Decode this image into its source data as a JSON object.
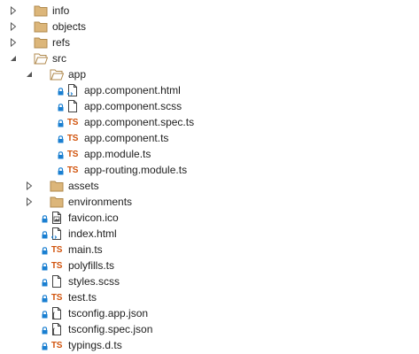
{
  "tree": [
    {
      "label": "info",
      "type": "folder",
      "expanded": false,
      "depth": 0
    },
    {
      "label": "objects",
      "type": "folder",
      "expanded": false,
      "depth": 0
    },
    {
      "label": "refs",
      "type": "folder",
      "expanded": false,
      "depth": 0
    },
    {
      "label": "src",
      "type": "folder",
      "expanded": true,
      "depth": 0
    },
    {
      "label": "app",
      "type": "folder",
      "expanded": true,
      "depth": 1
    },
    {
      "label": "app.component.html",
      "type": "html",
      "locked": true,
      "depth": 2
    },
    {
      "label": "app.component.scss",
      "type": "scss",
      "locked": true,
      "depth": 2
    },
    {
      "label": "app.component.spec.ts",
      "type": "ts",
      "locked": true,
      "depth": 2
    },
    {
      "label": "app.component.ts",
      "type": "ts",
      "locked": true,
      "depth": 2
    },
    {
      "label": "app.module.ts",
      "type": "ts",
      "locked": true,
      "depth": 2
    },
    {
      "label": "app-routing.module.ts",
      "type": "ts",
      "locked": true,
      "depth": 2
    },
    {
      "label": "assets",
      "type": "folder",
      "expanded": false,
      "depth": 1
    },
    {
      "label": "environments",
      "type": "folder",
      "expanded": false,
      "depth": 1
    },
    {
      "label": "favicon.ico",
      "type": "image",
      "locked": true,
      "depth": 1
    },
    {
      "label": "index.html",
      "type": "html",
      "locked": true,
      "depth": 1
    },
    {
      "label": "main.ts",
      "type": "ts",
      "locked": true,
      "depth": 1
    },
    {
      "label": "polyfills.ts",
      "type": "ts",
      "locked": true,
      "depth": 1
    },
    {
      "label": "styles.scss",
      "type": "scss",
      "locked": true,
      "depth": 1
    },
    {
      "label": "test.ts",
      "type": "ts",
      "locked": true,
      "depth": 1
    },
    {
      "label": "tsconfig.app.json",
      "type": "json",
      "locked": true,
      "depth": 1
    },
    {
      "label": "tsconfig.spec.json",
      "type": "json",
      "locked": true,
      "depth": 1
    },
    {
      "label": "typings.d.ts",
      "type": "ts",
      "locked": true,
      "depth": 1
    }
  ],
  "colors": {
    "folder_fill": "#dcb67a",
    "folder_stroke": "#b08a4e",
    "ts_badge": "#d1540d",
    "lock": "#1a7fd1",
    "html_badge": "#1a7fd1",
    "toggle": "#555555"
  }
}
